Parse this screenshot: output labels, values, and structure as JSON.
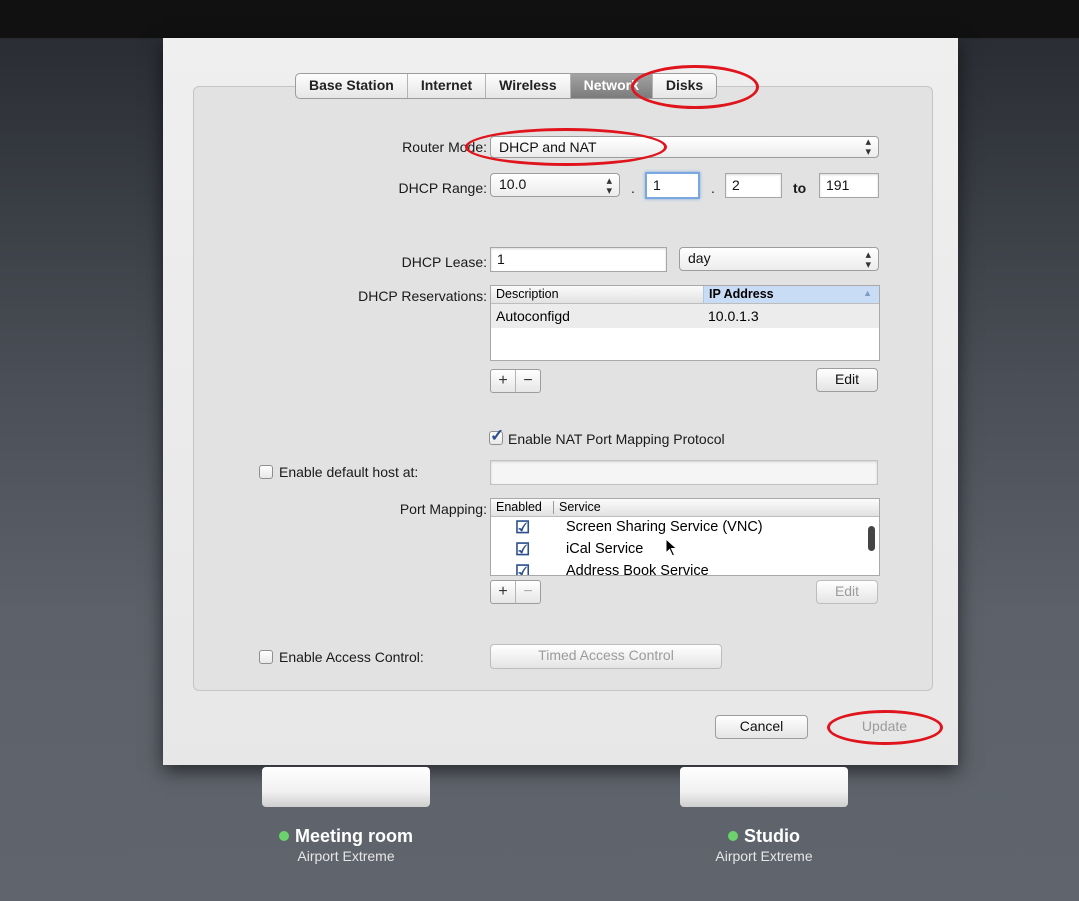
{
  "tabs": [
    {
      "label": "Base Station",
      "selected": false
    },
    {
      "label": "Internet",
      "selected": false
    },
    {
      "label": "Wireless",
      "selected": false
    },
    {
      "label": "Network",
      "selected": true
    },
    {
      "label": "Disks",
      "selected": false
    }
  ],
  "router_mode": {
    "label": "Router Mode:",
    "value": "DHCP and NAT"
  },
  "dhcp_range": {
    "label": "DHCP Range:",
    "prefix": "10.0",
    "dot1": ".",
    "octet3": "1",
    "dot2": ".",
    "start": "2",
    "to": "to",
    "end": "191"
  },
  "dhcp_lease": {
    "label": "DHCP Lease:",
    "value": "1",
    "unit": "day"
  },
  "reservations": {
    "label": "DHCP Reservations:",
    "columns": [
      "Description",
      "IP Address"
    ],
    "rows": [
      {
        "description": "Autoconfigd",
        "ip": "10.0.1.3"
      }
    ],
    "add": "+",
    "remove": "−",
    "edit": "Edit"
  },
  "nat_pmp": {
    "label": "Enable NAT Port Mapping Protocol",
    "checked": true
  },
  "default_host": {
    "label": "Enable default host at:",
    "checked": false,
    "value": ""
  },
  "port_mapping": {
    "label": "Port Mapping:",
    "columns": [
      "Enabled",
      "Service"
    ],
    "rows": [
      {
        "enabled": true,
        "service": "Screen Sharing Service (VNC)"
      },
      {
        "enabled": true,
        "service": "iCal Service"
      },
      {
        "enabled": true,
        "service": "Address Book Service"
      }
    ],
    "add": "+",
    "remove": "−",
    "edit": "Edit"
  },
  "access_control": {
    "label": "Enable Access Control:",
    "checked": false,
    "button": "Timed Access Control"
  },
  "footer": {
    "cancel": "Cancel",
    "update": "Update"
  },
  "devices": [
    {
      "name": "Meeting room",
      "model": "Airport Extreme",
      "status_color": "#6cd26c"
    },
    {
      "name": "Studio",
      "model": "Airport Extreme",
      "status_color": "#6cd26c"
    }
  ],
  "colors": {
    "highlight_ring": "#e0141c",
    "selected_tab": "#8c8c8c",
    "column_highlight": "#c9dcf5"
  }
}
